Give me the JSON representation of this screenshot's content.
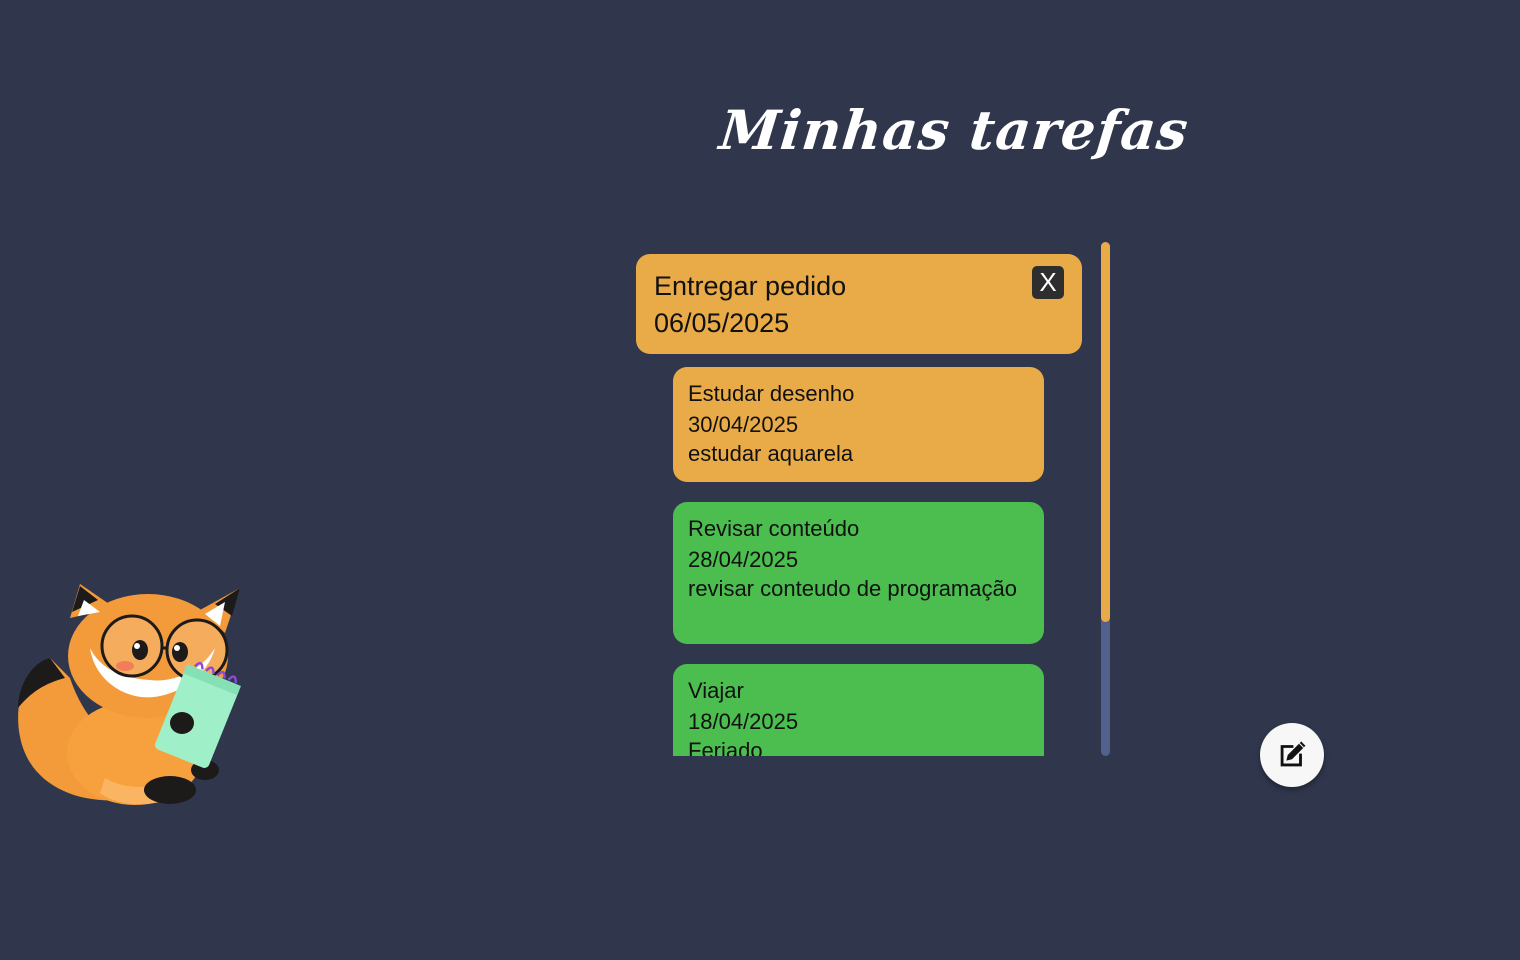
{
  "page": {
    "title": "Minhas tarefas"
  },
  "selected_task": {
    "title": "Entregar pedido",
    "date": "06/05/2025",
    "close_label": "X"
  },
  "tasks": [
    {
      "title": "Estudar desenho",
      "date": "30/04/2025",
      "description": "estudar aquarela",
      "color": "#e9ab48"
    },
    {
      "title": "Revisar conteúdo",
      "date": "28/04/2025",
      "description": "revisar conteudo de programação",
      "color": "#4cbd4f"
    },
    {
      "title": "Viajar",
      "date": "18/04/2025",
      "description": "Feriado",
      "color": "#4cbd4f"
    }
  ],
  "colors": {
    "background": "#30374d",
    "pending": "#e9ab48",
    "done": "#4cbd4f",
    "scroll_track": "#52608d"
  },
  "icons": {
    "edit": "edit-icon",
    "mascot": "fox-mascot-illustration"
  }
}
